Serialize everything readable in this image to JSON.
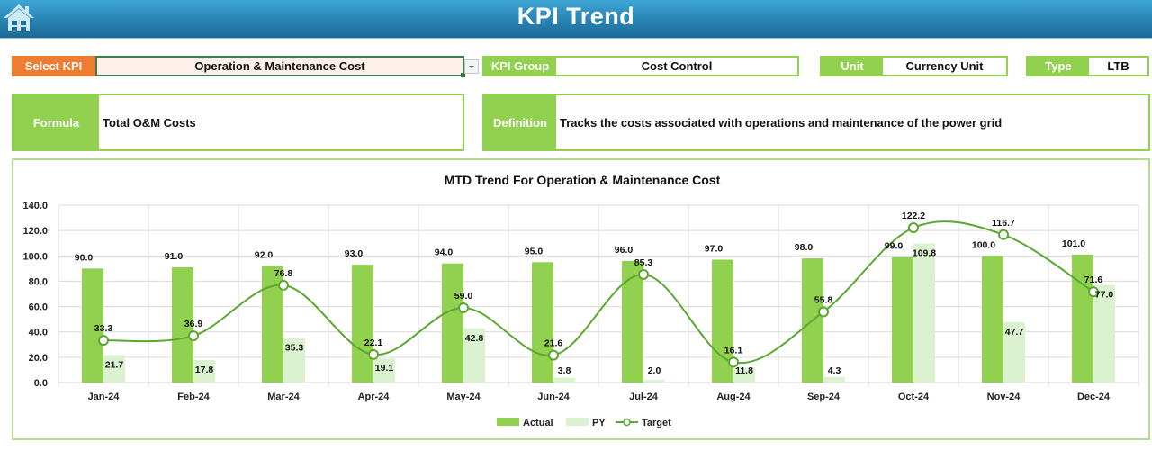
{
  "header": {
    "title": "KPI Trend",
    "home_icon": "home-icon"
  },
  "selector": {
    "label": "Select KPI",
    "value": "Operation & Maintenance Cost",
    "dropdown_icon": "chevron-down-icon"
  },
  "info": {
    "kpi_group": {
      "label": "KPI Group",
      "value": "Cost Control"
    },
    "unit": {
      "label": "Unit",
      "value": "Currency Unit"
    },
    "type": {
      "label": "Type",
      "value": "LTB"
    },
    "formula": {
      "label": "Formula",
      "value": "Total O&M Costs"
    },
    "definition": {
      "label": "Definition",
      "value": "Tracks the costs associated with operations and maintenance of the power grid"
    }
  },
  "colors": {
    "actual": "#92d050",
    "py": "#daf2d0",
    "target": "#5aa832",
    "accent_orange": "#ed7d31",
    "header_blue": "#2a86b7"
  },
  "chart_data": {
    "type": "bar",
    "title": "MTD Trend For Operation & Maintenance Cost",
    "xlabel": "",
    "ylabel": "",
    "categories": [
      "Jan-24",
      "Feb-24",
      "Mar-24",
      "Apr-24",
      "May-24",
      "Jun-24",
      "Jul-24",
      "Aug-24",
      "Sep-24",
      "Oct-24",
      "Nov-24",
      "Dec-24"
    ],
    "series": [
      {
        "name": "Actual",
        "type": "bar",
        "values": [
          90.0,
          91.0,
          92.0,
          93.0,
          94.0,
          95.0,
          96.0,
          97.0,
          98.0,
          99.0,
          100.0,
          101.0
        ]
      },
      {
        "name": "PY",
        "type": "bar",
        "values": [
          21.7,
          17.8,
          35.3,
          19.1,
          42.8,
          3.8,
          2.0,
          11.8,
          4.3,
          109.8,
          47.7,
          77.0
        ]
      },
      {
        "name": "Target",
        "type": "line",
        "smooth": true,
        "marker": "circle",
        "values": [
          33.3,
          36.9,
          76.8,
          22.1,
          59.0,
          21.6,
          85.3,
          16.1,
          55.8,
          122.2,
          116.7,
          71.6
        ]
      }
    ],
    "ylim": [
      0,
      140
    ],
    "yticks": [
      "0.0",
      "20.0",
      "40.0",
      "60.0",
      "80.0",
      "100.0",
      "120.0",
      "140.0"
    ],
    "grid": true,
    "legend": {
      "position": "bottom",
      "entries": [
        "Actual",
        "PY",
        "Target"
      ]
    }
  }
}
